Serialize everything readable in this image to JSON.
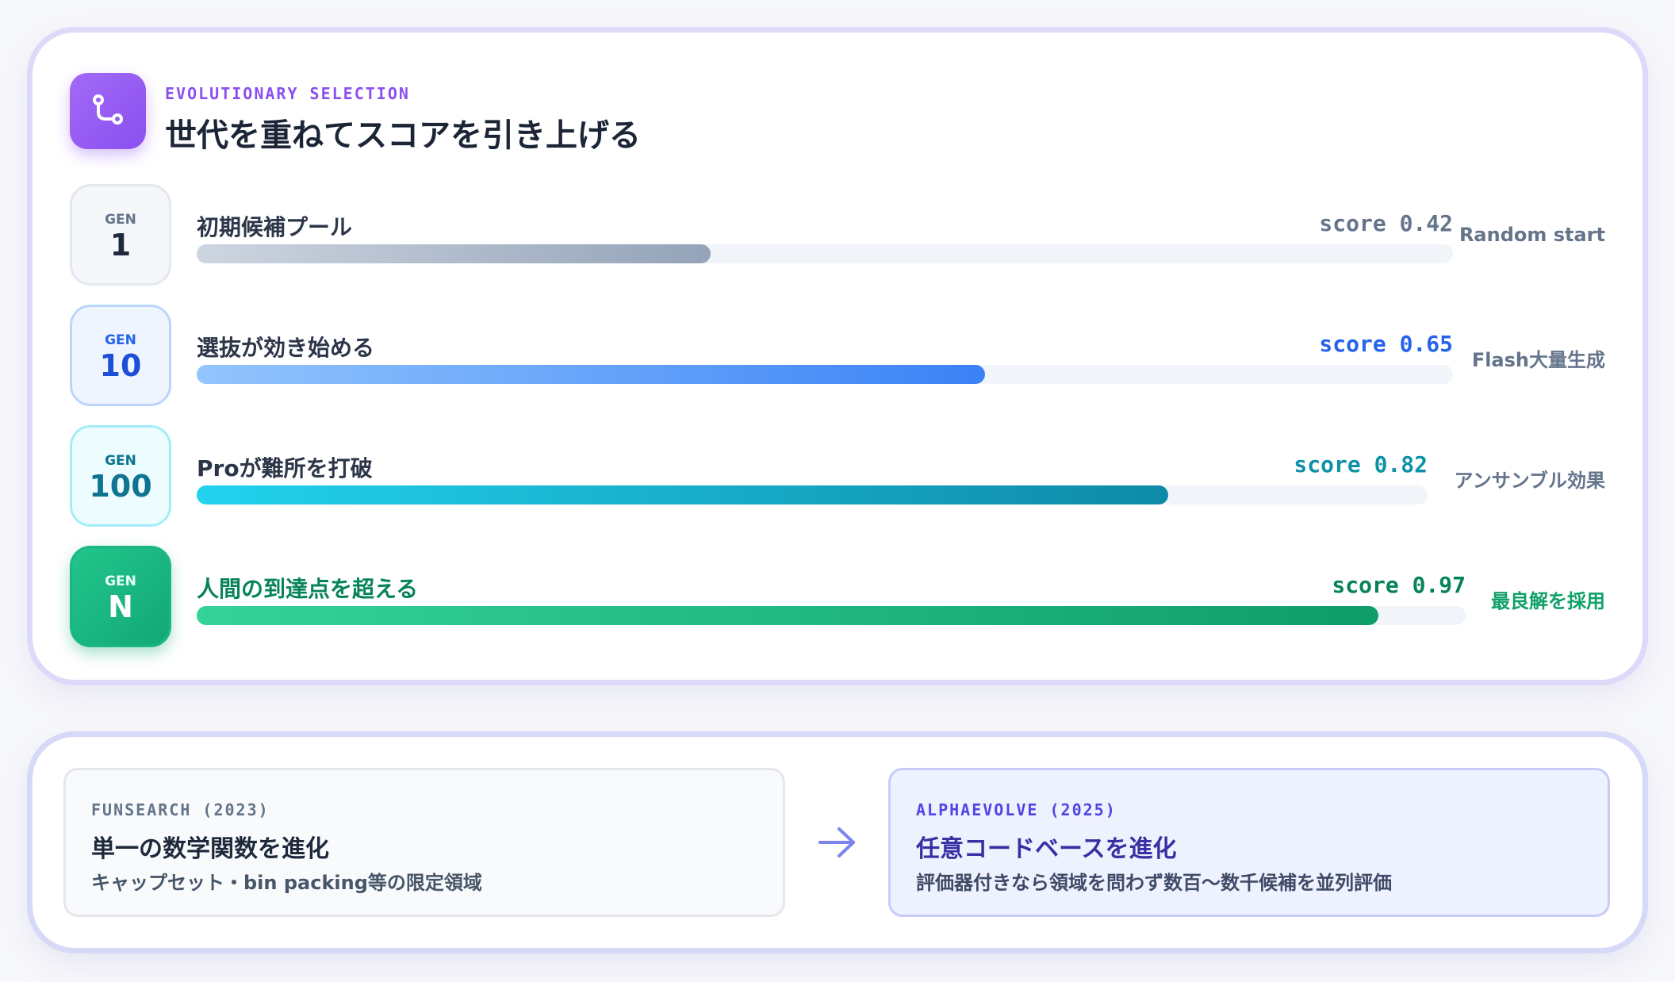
{
  "header": {
    "icon": "branch-icon",
    "kicker": "EVOLUTIONARY SELECTION",
    "title": "世代を重ねてスコアを引き上げる"
  },
  "generations": [
    {
      "gen_label": "GEN",
      "gen_value": "1",
      "label": "初期候補プール",
      "score_text": "score 0.42",
      "score": 0.42,
      "note": "Random start",
      "color": "#94a3b8"
    },
    {
      "gen_label": "GEN",
      "gen_value": "10",
      "label": "選抜が効き始める",
      "score_text": "score 0.65",
      "score": 0.65,
      "note": "Flash大量生成",
      "color": "#3b82f6"
    },
    {
      "gen_label": "GEN",
      "gen_value": "100",
      "label": "Proが難所を打破",
      "score_text": "score 0.82",
      "score": 0.82,
      "note": "アンサンブル効果",
      "color": "#0e91a8"
    },
    {
      "gen_label": "GEN",
      "gen_value": "N",
      "label": "人間の到達点を超える",
      "score_text": "score 0.97",
      "score": 0.97,
      "note": "最良解を採用",
      "color": "#10b981"
    }
  ],
  "comparison": {
    "left": {
      "kicker": "FUNSEARCH (2023)",
      "title": "単一の数学関数を進化",
      "desc": "キャップセット・bin packing等の限定領域"
    },
    "arrow_icon": "arrow-right-icon",
    "right": {
      "kicker": "ALPHAEVOLVE (2025)",
      "title": "任意コードベースを進化",
      "desc": "評価器付きなら領域を問わず数百〜数千候補を並列評価"
    }
  }
}
